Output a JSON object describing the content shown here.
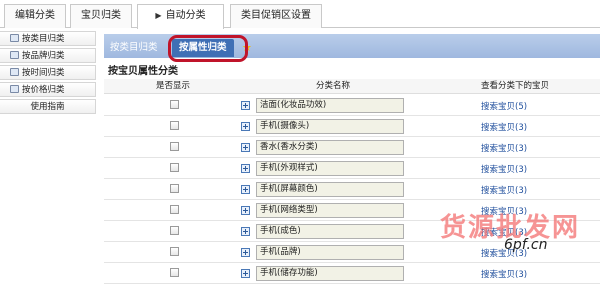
{
  "top_tabs": [
    {
      "label": "编辑分类",
      "arrow": ""
    },
    {
      "label": "宝贝归类",
      "arrow": ""
    },
    {
      "label": "自动分类",
      "arrow": "▶"
    },
    {
      "label": "类目促销区设置",
      "arrow": ""
    }
  ],
  "sidebar": {
    "items": [
      {
        "label": "按类目归类",
        "icon": "category-icon"
      },
      {
        "label": "按品牌归类",
        "icon": "brand-icon"
      },
      {
        "label": "按时间归类",
        "icon": "clock-icon"
      },
      {
        "label": "按价格归类",
        "icon": "price-icon"
      },
      {
        "label": "使用指南",
        "icon": ""
      }
    ]
  },
  "main": {
    "subtabs": [
      "按类目归类",
      "按属性归类"
    ],
    "star_icon": "star-icon",
    "section_title": "按宝贝属性分类",
    "columns": [
      "是否显示",
      "分类名称",
      "查看分类下的宝贝"
    ],
    "rows": [
      {
        "name": "洁面(化妆品功效)",
        "link": "搜索宝贝(5)"
      },
      {
        "name": "手机(摄像头)",
        "link": "搜索宝贝(3)"
      },
      {
        "name": "香水(香水分类)",
        "link": "搜索宝贝(3)"
      },
      {
        "name": "手机(外观样式)",
        "link": "搜索宝贝(3)"
      },
      {
        "name": "手机(屏幕颜色)",
        "link": "搜索宝贝(3)"
      },
      {
        "name": "手机(网络类型)",
        "link": "搜索宝贝(3)"
      },
      {
        "name": "手机(成色)",
        "link": "搜索宝贝(3)"
      },
      {
        "name": "手机(品牌)",
        "link": "搜索宝贝(3)"
      },
      {
        "name": "手机(储存功能)",
        "link": "搜索宝贝(3)"
      }
    ]
  },
  "watermark": {
    "text": "货源批发网",
    "url": "6pf.cn"
  },
  "colors": {
    "accent": "#3f6fb5",
    "highlight": "#c0142a",
    "link": "#1f4e9c"
  }
}
